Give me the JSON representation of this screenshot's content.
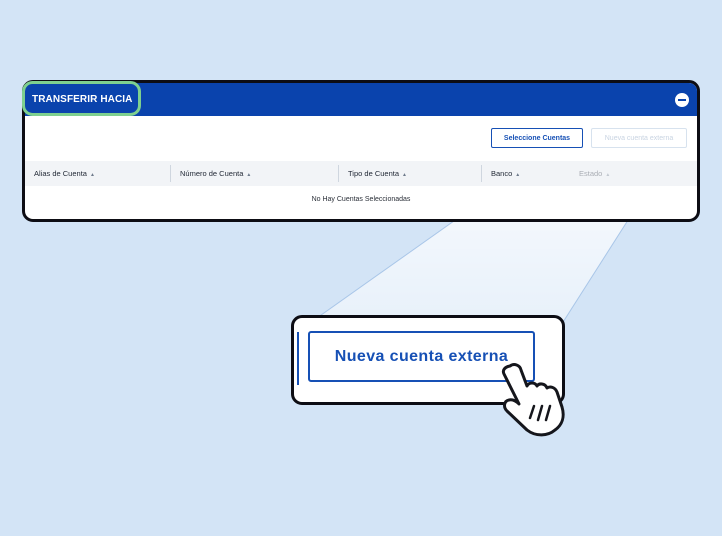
{
  "panel": {
    "title": "TRANSFERIR HACIA",
    "select_button": "Seleccione Cuentas",
    "faded_button": "Nueva cuenta externa",
    "columns": [
      {
        "label": "Alias de Cuenta"
      },
      {
        "label": "Número de Cuenta"
      },
      {
        "label": "Tipo de Cuenta"
      },
      {
        "label": "Banco"
      },
      {
        "label": "Estado"
      }
    ],
    "empty_message": "No Hay Cuentas Seleccionadas"
  },
  "zoom": {
    "button_label": "Nueva cuenta externa"
  },
  "colors": {
    "background": "#d3e4f6",
    "header_blue": "#0a43ad",
    "accent_blue": "#1650b5",
    "highlight_green": "#7ed08f",
    "border_dark": "#0d0d14"
  },
  "icons": {
    "collapse": "minus-circle-icon",
    "pointer": "hand-pointer-icon"
  }
}
